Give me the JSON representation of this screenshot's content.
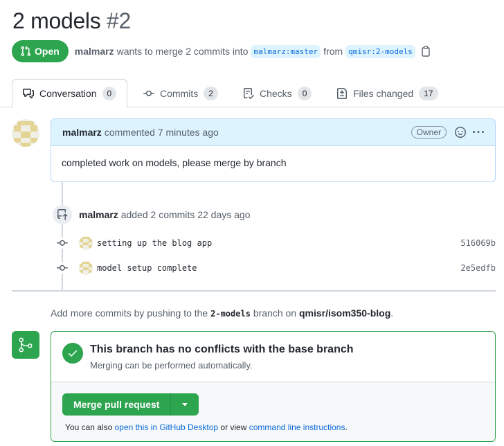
{
  "pr": {
    "title": "2 models",
    "number": "#2",
    "state": "Open",
    "author": "malmarz",
    "merge_text": "wants to merge 2 commits into",
    "base_branch": "malmarz:master",
    "from_text": "from",
    "head_branch": "qmisr:2-models"
  },
  "tabs": [
    {
      "label": "Conversation",
      "count": "0",
      "icon": "comment-discussion-icon"
    },
    {
      "label": "Commits",
      "count": "2",
      "icon": "git-commit-icon"
    },
    {
      "label": "Checks",
      "count": "0",
      "icon": "checklist-icon"
    },
    {
      "label": "Files changed",
      "count": "17",
      "icon": "file-diff-icon"
    }
  ],
  "comment": {
    "author": "malmarz",
    "action": "commented 7 minutes ago",
    "role": "Owner",
    "body": "completed work on models, please merge by branch"
  },
  "event": {
    "author": "malmarz",
    "text": "added 2 commits 22 days ago"
  },
  "commits": [
    {
      "message": "setting up the blog app",
      "sha": "516069b"
    },
    {
      "message": "model setup complete",
      "sha": "2e5edfb"
    }
  ],
  "push_note": {
    "before": "Add more commits by pushing to the",
    "branch": "2-models",
    "middle": "branch on",
    "repo": "qmisr/isom350-blog",
    "after": "."
  },
  "merge": {
    "status_title": "This branch has no conflicts with the base branch",
    "status_sub": "Merging can be performed automatically.",
    "button_label": "Merge pull request",
    "also_before": "You can also",
    "desktop_link": "open this in GitHub Desktop",
    "also_middle": "or view",
    "cli_link": "command line instructions",
    "also_after": "."
  },
  "colors": {
    "green": "#2da44e",
    "link": "#0969da",
    "comment_header_bg": "#ddf4ff"
  }
}
